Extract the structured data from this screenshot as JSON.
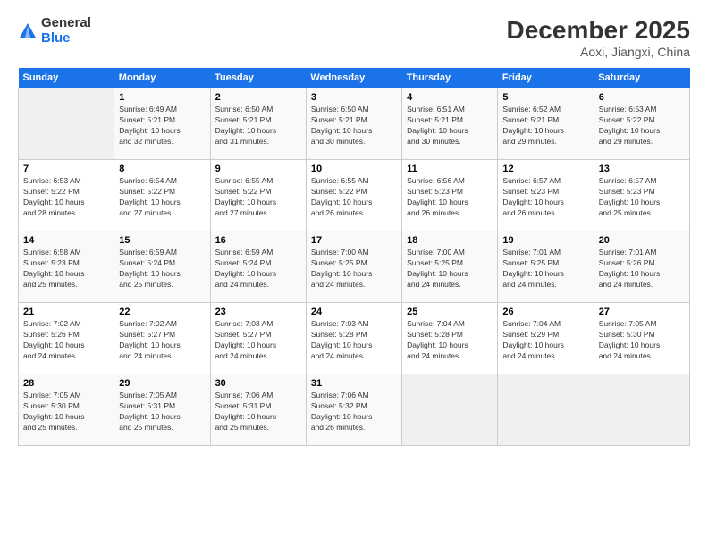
{
  "logo": {
    "general": "General",
    "blue": "Blue"
  },
  "title": "December 2025",
  "subtitle": "Aoxi, Jiangxi, China",
  "days_of_week": [
    "Sunday",
    "Monday",
    "Tuesday",
    "Wednesday",
    "Thursday",
    "Friday",
    "Saturday"
  ],
  "weeks": [
    [
      {
        "num": "",
        "info": ""
      },
      {
        "num": "1",
        "info": "Sunrise: 6:49 AM\nSunset: 5:21 PM\nDaylight: 10 hours\nand 32 minutes."
      },
      {
        "num": "2",
        "info": "Sunrise: 6:50 AM\nSunset: 5:21 PM\nDaylight: 10 hours\nand 31 minutes."
      },
      {
        "num": "3",
        "info": "Sunrise: 6:50 AM\nSunset: 5:21 PM\nDaylight: 10 hours\nand 30 minutes."
      },
      {
        "num": "4",
        "info": "Sunrise: 6:51 AM\nSunset: 5:21 PM\nDaylight: 10 hours\nand 30 minutes."
      },
      {
        "num": "5",
        "info": "Sunrise: 6:52 AM\nSunset: 5:21 PM\nDaylight: 10 hours\nand 29 minutes."
      },
      {
        "num": "6",
        "info": "Sunrise: 6:53 AM\nSunset: 5:22 PM\nDaylight: 10 hours\nand 29 minutes."
      }
    ],
    [
      {
        "num": "7",
        "info": "Sunrise: 6:53 AM\nSunset: 5:22 PM\nDaylight: 10 hours\nand 28 minutes."
      },
      {
        "num": "8",
        "info": "Sunrise: 6:54 AM\nSunset: 5:22 PM\nDaylight: 10 hours\nand 27 minutes."
      },
      {
        "num": "9",
        "info": "Sunrise: 6:55 AM\nSunset: 5:22 PM\nDaylight: 10 hours\nand 27 minutes."
      },
      {
        "num": "10",
        "info": "Sunrise: 6:55 AM\nSunset: 5:22 PM\nDaylight: 10 hours\nand 26 minutes."
      },
      {
        "num": "11",
        "info": "Sunrise: 6:56 AM\nSunset: 5:23 PM\nDaylight: 10 hours\nand 26 minutes."
      },
      {
        "num": "12",
        "info": "Sunrise: 6:57 AM\nSunset: 5:23 PM\nDaylight: 10 hours\nand 26 minutes."
      },
      {
        "num": "13",
        "info": "Sunrise: 6:57 AM\nSunset: 5:23 PM\nDaylight: 10 hours\nand 25 minutes."
      }
    ],
    [
      {
        "num": "14",
        "info": "Sunrise: 6:58 AM\nSunset: 5:23 PM\nDaylight: 10 hours\nand 25 minutes."
      },
      {
        "num": "15",
        "info": "Sunrise: 6:59 AM\nSunset: 5:24 PM\nDaylight: 10 hours\nand 25 minutes."
      },
      {
        "num": "16",
        "info": "Sunrise: 6:59 AM\nSunset: 5:24 PM\nDaylight: 10 hours\nand 24 minutes."
      },
      {
        "num": "17",
        "info": "Sunrise: 7:00 AM\nSunset: 5:25 PM\nDaylight: 10 hours\nand 24 minutes."
      },
      {
        "num": "18",
        "info": "Sunrise: 7:00 AM\nSunset: 5:25 PM\nDaylight: 10 hours\nand 24 minutes."
      },
      {
        "num": "19",
        "info": "Sunrise: 7:01 AM\nSunset: 5:25 PM\nDaylight: 10 hours\nand 24 minutes."
      },
      {
        "num": "20",
        "info": "Sunrise: 7:01 AM\nSunset: 5:26 PM\nDaylight: 10 hours\nand 24 minutes."
      }
    ],
    [
      {
        "num": "21",
        "info": "Sunrise: 7:02 AM\nSunset: 5:26 PM\nDaylight: 10 hours\nand 24 minutes."
      },
      {
        "num": "22",
        "info": "Sunrise: 7:02 AM\nSunset: 5:27 PM\nDaylight: 10 hours\nand 24 minutes."
      },
      {
        "num": "23",
        "info": "Sunrise: 7:03 AM\nSunset: 5:27 PM\nDaylight: 10 hours\nand 24 minutes."
      },
      {
        "num": "24",
        "info": "Sunrise: 7:03 AM\nSunset: 5:28 PM\nDaylight: 10 hours\nand 24 minutes."
      },
      {
        "num": "25",
        "info": "Sunrise: 7:04 AM\nSunset: 5:28 PM\nDaylight: 10 hours\nand 24 minutes."
      },
      {
        "num": "26",
        "info": "Sunrise: 7:04 AM\nSunset: 5:29 PM\nDaylight: 10 hours\nand 24 minutes."
      },
      {
        "num": "27",
        "info": "Sunrise: 7:05 AM\nSunset: 5:30 PM\nDaylight: 10 hours\nand 24 minutes."
      }
    ],
    [
      {
        "num": "28",
        "info": "Sunrise: 7:05 AM\nSunset: 5:30 PM\nDaylight: 10 hours\nand 25 minutes."
      },
      {
        "num": "29",
        "info": "Sunrise: 7:05 AM\nSunset: 5:31 PM\nDaylight: 10 hours\nand 25 minutes."
      },
      {
        "num": "30",
        "info": "Sunrise: 7:06 AM\nSunset: 5:31 PM\nDaylight: 10 hours\nand 25 minutes."
      },
      {
        "num": "31",
        "info": "Sunrise: 7:06 AM\nSunset: 5:32 PM\nDaylight: 10 hours\nand 26 minutes."
      },
      {
        "num": "",
        "info": ""
      },
      {
        "num": "",
        "info": ""
      },
      {
        "num": "",
        "info": ""
      }
    ]
  ]
}
